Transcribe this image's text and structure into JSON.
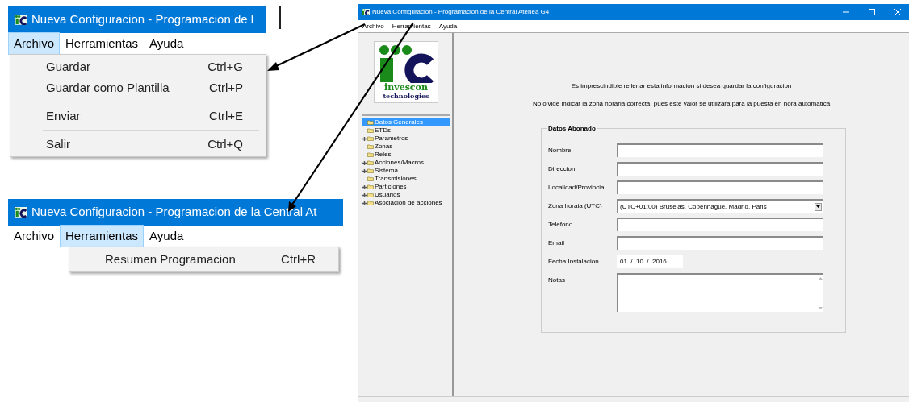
{
  "archivo_inset": {
    "title": "Nueva Configuracion - Programacion de l",
    "menubar": [
      {
        "label": "Archivo",
        "selected": true
      },
      {
        "label": "Herramientas",
        "selected": false
      },
      {
        "label": "Ayuda",
        "selected": false
      }
    ],
    "menu": [
      {
        "kind": "item",
        "label": "Guardar",
        "shortcut": "Ctrl+G"
      },
      {
        "kind": "item",
        "label": "Guardar como Plantilla",
        "shortcut": "Ctrl+P"
      },
      {
        "kind": "separator"
      },
      {
        "kind": "item",
        "label": "Enviar",
        "shortcut": "Ctrl+E"
      },
      {
        "kind": "separator"
      },
      {
        "kind": "item",
        "label": "Salir",
        "shortcut": "Ctrl+Q"
      }
    ]
  },
  "herramientas_inset": {
    "title": "Nueva Configuracion - Programacion de la Central At",
    "menubar": [
      {
        "label": "Archivo",
        "selected": false
      },
      {
        "label": "Herramientas",
        "selected": true
      },
      {
        "label": "Ayuda",
        "selected": false
      }
    ],
    "menu": [
      {
        "kind": "item",
        "label": "Resumen Programacion",
        "shortcut": "Ctrl+R"
      }
    ]
  },
  "window": {
    "title": "Nueva Configuracion - Programacion de la Central Atenea G4",
    "menubar": [
      "Archivo",
      "Herramientas",
      "Ayuda"
    ],
    "logo": {
      "line_1": "invescon",
      "line_2": "technologies"
    },
    "tree": [
      {
        "label": "Datos Generales",
        "expandable": false,
        "selected": true
      },
      {
        "label": "ETDs",
        "expandable": false,
        "selected": false
      },
      {
        "label": "Parametros",
        "expandable": true,
        "selected": false
      },
      {
        "label": "Zonas",
        "expandable": false,
        "selected": false
      },
      {
        "label": "Reles",
        "expandable": false,
        "selected": false
      },
      {
        "label": "Acciones/Macros",
        "expandable": true,
        "selected": false
      },
      {
        "label": "Sistema",
        "expandable": true,
        "selected": false
      },
      {
        "label": "Transmisiones",
        "expandable": false,
        "selected": false
      },
      {
        "label": "Particiones",
        "expandable": true,
        "selected": false
      },
      {
        "label": "Usuarios",
        "expandable": true,
        "selected": false
      },
      {
        "label": "Asociacion de acciones",
        "expandable": true,
        "selected": false
      }
    ],
    "notices": [
      "Es imprescindible rellenar esta informacion si desea guardar la configuracion",
      "No olvide indicar la zona horaria correcta, pues este valor se utilizara para la puesta en hora automatica"
    ],
    "group": {
      "title": "Datos Abonado",
      "fields": [
        {
          "kind": "text",
          "label": "Nombre"
        },
        {
          "kind": "text",
          "label": "Direccion"
        },
        {
          "kind": "text",
          "label": "Localidad/Provincia"
        },
        {
          "kind": "select",
          "label": "Zona horaia (UTC)",
          "value": "(UTC+01:00) Bruselas, Copenhague, Madrid, Paris"
        },
        {
          "kind": "text",
          "label": "Telefono"
        },
        {
          "kind": "text",
          "label": "Email"
        },
        {
          "kind": "date",
          "label": "Fecha Instalacion",
          "value": "01  /  10  /  2016"
        },
        {
          "kind": "textarea",
          "label": "Notas"
        }
      ]
    }
  }
}
